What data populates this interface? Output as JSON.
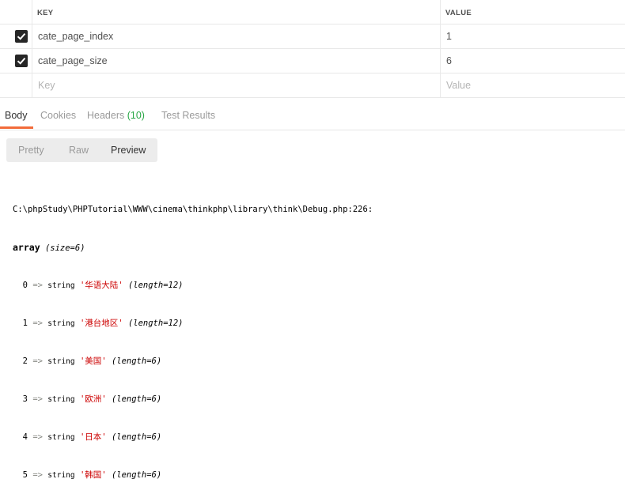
{
  "params": {
    "header": {
      "key": "KEY",
      "value": "VALUE"
    },
    "rows": [
      {
        "key": "cate_page_index",
        "value": "1"
      },
      {
        "key": "cate_page_size",
        "value": "6"
      }
    ],
    "placeholder": {
      "key": "Key",
      "value": "Value"
    }
  },
  "tabs": {
    "body": "Body",
    "cookies": "Cookies",
    "headers": "Headers",
    "headers_count": "(10)",
    "test_results": "Test Results"
  },
  "view_modes": {
    "pretty": "Pretty",
    "raw": "Raw",
    "preview": "Preview"
  },
  "output": {
    "path": "C:\\phpStudy\\PHPTutorial\\WWW\\cinema\\thinkphp\\library\\think\\Debug.php:226:",
    "type_keyword": "array",
    "size_info": "(size=6)",
    "items": [
      {
        "index": "0",
        "type": "string",
        "value": "'华语大陆'",
        "length": "(length=12)"
      },
      {
        "index": "1",
        "type": "string",
        "value": "'港台地区'",
        "length": "(length=12)"
      },
      {
        "index": "2",
        "type": "string",
        "value": "'美国'",
        "length": "(length=6)"
      },
      {
        "index": "3",
        "type": "string",
        "value": "'欧洲'",
        "length": "(length=6)"
      },
      {
        "index": "4",
        "type": "string",
        "value": "'日本'",
        "length": "(length=6)"
      },
      {
        "index": "5",
        "type": "string",
        "value": "'韩国'",
        "length": "(length=6)"
      }
    ],
    "arrow": "=>"
  },
  "colors": {
    "accent": "#f26b3a",
    "count": "#28a745",
    "string": "#cc0000"
  }
}
